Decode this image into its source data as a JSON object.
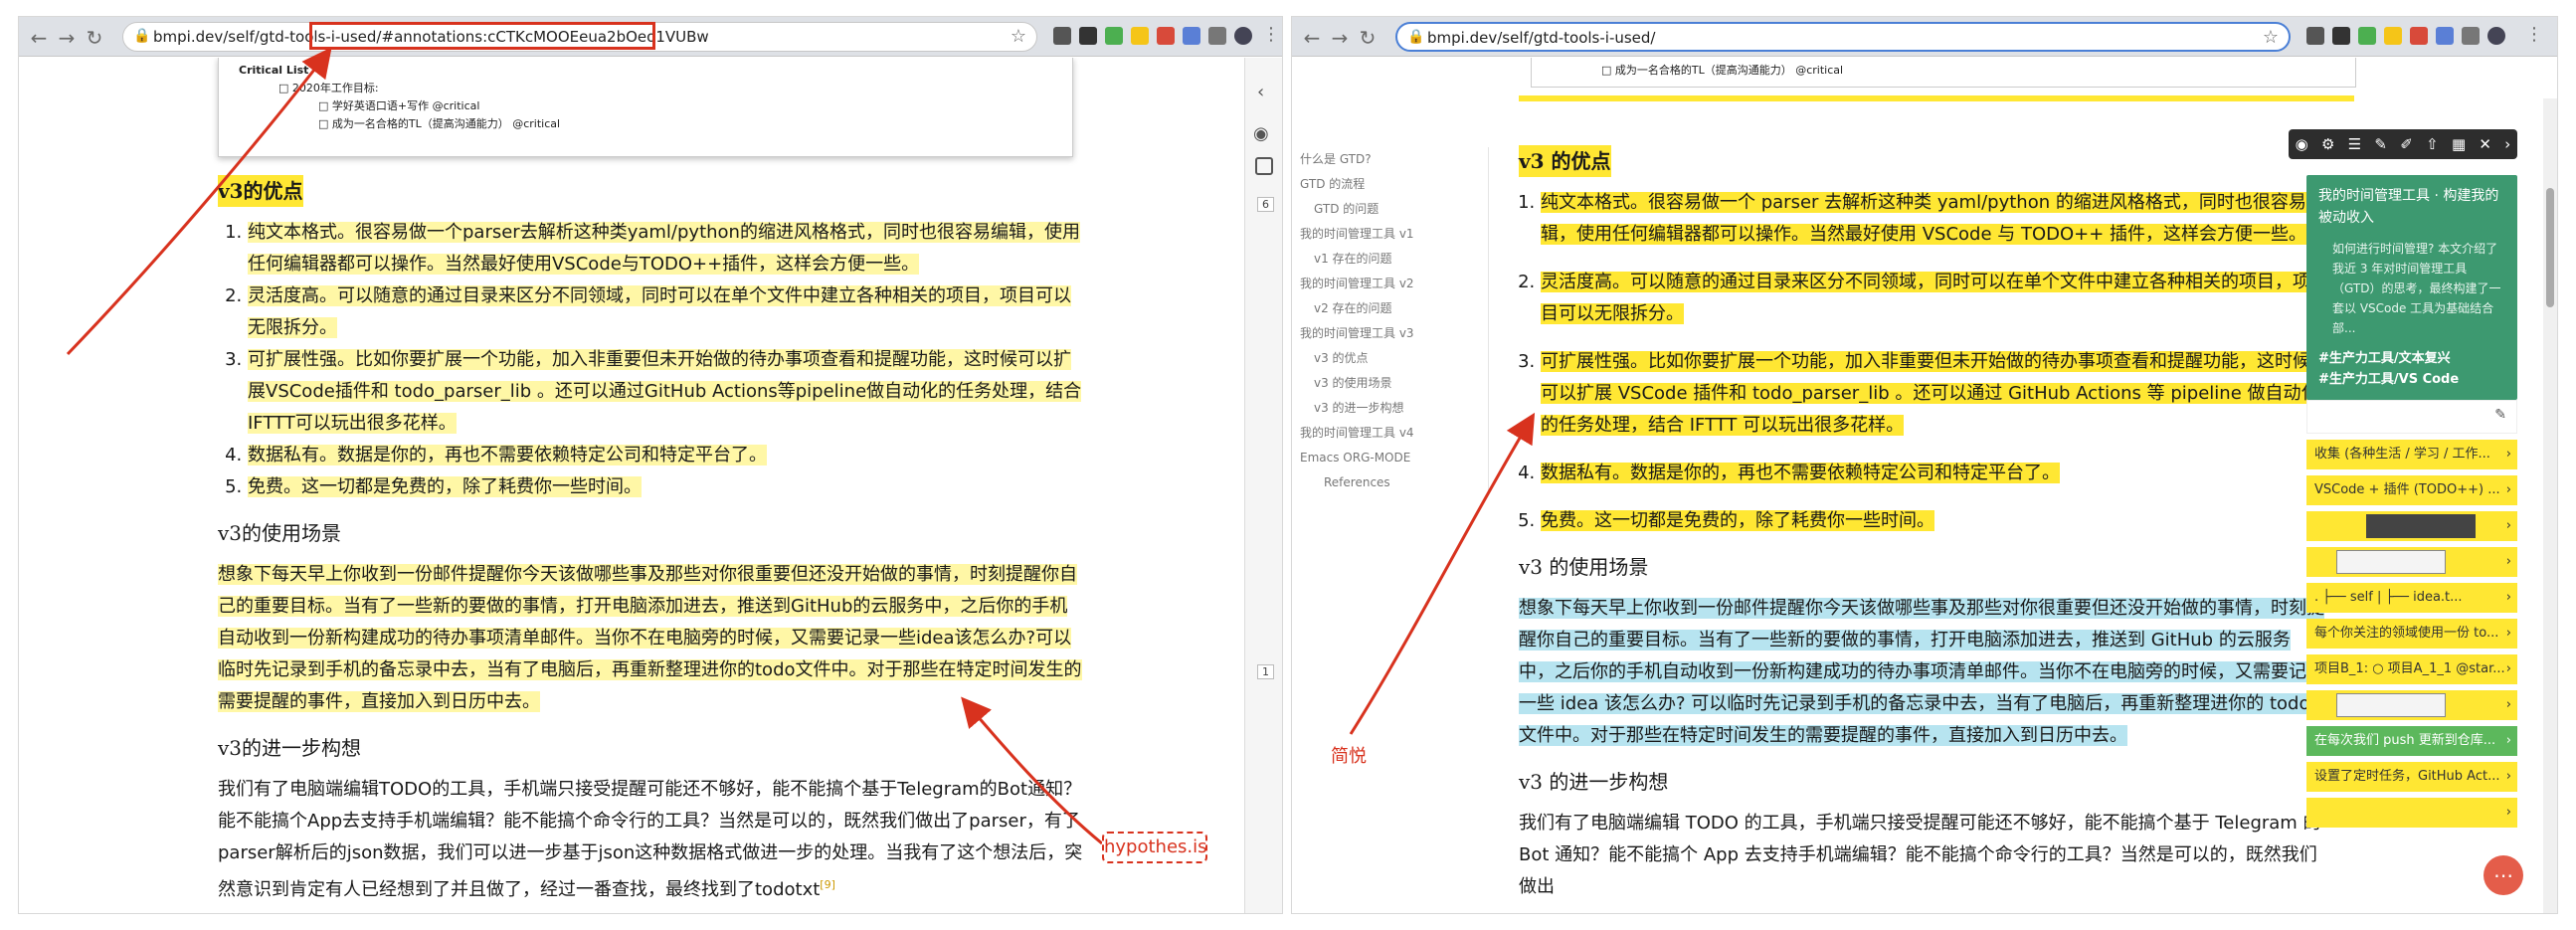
{
  "left": {
    "url": "bmpi.dev/self/gtd-tools-i-used/",
    "url_fragment": "#annotations:cCTKcMOOEeua2bOeo1VUBw",
    "snippet": {
      "title": "Critical List",
      "line1": "□ 2020年工作目标:",
      "line2": "□ 学好英语口语+写作 @critical",
      "line3": "□ 成为一名合格的TL（提高沟通能力） @critical"
    },
    "h_adv": "v3的优点",
    "adv": [
      "纯文本格式。很容易做一个parser去解析这种类yaml/python的缩进风格格式，同时也很容易编辑，使用任何编辑器都可以操作。当然最好使用VSCode与TODO++插件，这样会方便一些。",
      "灵活度高。可以随意的通过目录来区分不同领域，同时可以在单个文件中建立各种相关的项目，项目可以无限拆分。",
      "可扩展性强。比如你要扩展一个功能，加入非重要但未开始做的待办事项查看和提醒功能，这时候可以扩展VSCode插件和 todo_parser_lib 。还可以通过GitHub Actions等pipeline做自动化的任务处理，结合IFTTT可以玩出很多花样。",
      "数据私有。数据是你的，再也不需要依赖特定公司和特定平台了。",
      "免费。这一切都是免费的，除了耗费你一些时间。"
    ],
    "h_use": "v3的使用场景",
    "use_p": "想象下每天早上你收到一份邮件提醒你今天该做哪些事及那些对你很重要但还没开始做的事情，时刻提醒你自己的重要目标。当有了一些新的要做的事情，打开电脑添加进去，推送到GitHub的云服务中，之后你的手机自动收到一份新构建成功的待办事项清单邮件。当你不在电脑旁的时候，又需要记录一些idea该怎么办?可以临时先记录到手机的备忘录中去，当有了电脑后，再重新整理进你的todo文件中。对于那些在特定时间发生的需要提醒的事件，直接加入到日历中去。",
    "h_further": "v3的进一步构想",
    "further_p": "我们有了电脑端编辑TODO的工具，手机端只接受提醒可能还不够好，能不能搞个基于Telegram的Bot通知？能不能搞个App去支持手机端编辑？能不能搞个命令行的工具？当然是可以的，既然我们做出了parser，有了parser解析后的json数据，我们可以进一步基于json这种数据格式做进一步的处理。当我有了这个想法后，突然意识到肯定有人已经想到了并且做了，经过一番查找，最终找到了todotxt",
    "sidebar_counts": [
      "6",
      "1"
    ],
    "footnote": "[9]"
  },
  "right": {
    "url": "bmpi.dev/self/gtd-tools-i-used/",
    "snippet_line": "□ 成为一名合格的TL（提高沟通能力） @critical",
    "toc": [
      {
        "t": "什么是 GTD?",
        "lvl": 0
      },
      {
        "t": "GTD 的流程",
        "lvl": 0
      },
      {
        "t": "GTD 的问题",
        "lvl": 1
      },
      {
        "t": "我的时间管理工具 v1",
        "lvl": 0
      },
      {
        "t": "v1 存在的问题",
        "lvl": 1
      },
      {
        "t": "我的时间管理工具 v2",
        "lvl": 0
      },
      {
        "t": "v2 存在的问题",
        "lvl": 1
      },
      {
        "t": "我的时间管理工具 v3",
        "lvl": 0
      },
      {
        "t": "v3 的优点",
        "lvl": 1
      },
      {
        "t": "v3 的使用场景",
        "lvl": 1
      },
      {
        "t": "v3 的进一步构想",
        "lvl": 1
      },
      {
        "t": "我的时间管理工具 v4",
        "lvl": 0
      },
      {
        "t": "Emacs ORG-MODE",
        "lvl": 0
      },
      {
        "t": "References",
        "lvl": 2
      }
    ],
    "h_adv": "v3 的优点",
    "adv": [
      "纯文本格式。很容易做一个 parser 去解析这种类 yaml/python 的缩进风格格式，同时也很容易编辑，使用任何编辑器都可以操作。当然最好使用 VSCode 与 TODO++ 插件，这样会方便一些。",
      "灵活度高。可以随意的通过目录来区分不同领域，同时可以在单个文件中建立各种相关的项目，项目可以无限拆分。",
      "可扩展性强。比如你要扩展一个功能，加入非重要但未开始做的待办事项查看和提醒功能，这时候可以扩展 VSCode 插件和 todo_parser_lib 。还可以通过 GitHub Actions 等 pipeline 做自动化的任务处理，结合 IFTTT 可以玩出很多花样。",
      "数据私有。数据是你的，再也不需要依赖特定公司和特定平台了。",
      "免费。这一切都是免费的，除了耗费你一些时间。"
    ],
    "h_use": "v3 的使用场景",
    "use_p": "想象下每天早上你收到一份邮件提醒你今天该做哪些事及那些对你很重要但还没开始做的事情，时刻提醒你自己的重要目标。当有了一些新的要做的事情，打开电脑添加进去，推送到 GitHub 的云服务中，之后你的手机自动收到一份新构建成功的待办事项清单邮件。当你不在电脑旁的时候，又需要记录一些 idea 该怎么办? 可以临时先记录到手机的备忘录中去，当有了电脑后，再重新整理进你的 todo 文件中。对于那些在特定时间发生的需要提醒的事件，直接加入到日历中去。",
    "h_further": "v3 的进一步构想",
    "further_p": "我们有了电脑端编辑 TODO 的工具，手机端只接受提醒可能还不够好，能不能搞个基于 Telegram 的 Bot 通知？能不能搞个 App 去支持手机端编辑？能不能搞个命令行的工具？当然是可以的，既然我们做出",
    "card": {
      "title": "我的时间管理工具 · 构建我的被动收入",
      "desc": "如何进行时间管理? 本文介绍了我近 3 年对时间管理工具（GTD）的思考，最终构建了一套以 VSCode 工具为基础结合部...",
      "tag1": "#生产力工具/文本复兴",
      "tag2": "#生产力工具/VS Code"
    },
    "annotations": [
      {
        "text": "收集 (各种生活 / 学习 / 工作...",
        "kind": "text"
      },
      {
        "text": "VSCode + 插件 (TODO++) ...",
        "kind": "text"
      },
      {
        "text": "",
        "kind": "img"
      },
      {
        "text": "",
        "kind": "img2"
      },
      {
        "text": ". ├── self |    ├── idea.t...",
        "kind": "text"
      },
      {
        "text": "每个你关注的领域使用一份 to...",
        "kind": "text"
      },
      {
        "text": "项目B_1: ○ 项目A_1_1 @star...",
        "kind": "text"
      },
      {
        "text": "",
        "kind": "img2"
      },
      {
        "text": "在每次我们 push 更新到仓库...",
        "kind": "green"
      },
      {
        "text": "设置了定时任务，GitHub Act...",
        "kind": "text"
      },
      {
        "text": "",
        "kind": "text"
      }
    ]
  },
  "labels": {
    "hypothesis": "hypothes.is",
    "jianyue": "简悦"
  },
  "colors": {
    "highlight_yellow": "#fff7a6",
    "highlight_strong": "#ffe733",
    "highlight_blue": "#b7e4f0",
    "card_green": "#3d9970",
    "arrow_red": "#d8321e"
  }
}
